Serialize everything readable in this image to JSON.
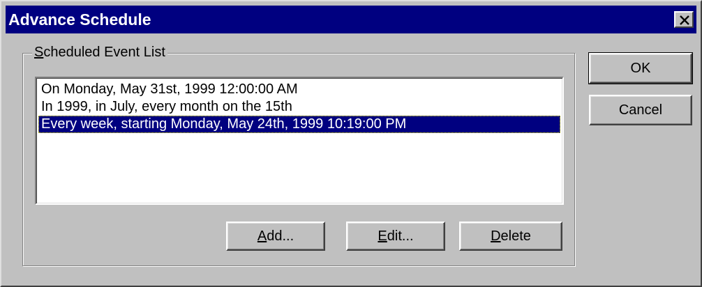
{
  "window": {
    "title": "Advance Schedule",
    "close_icon": "close-icon"
  },
  "group": {
    "legend_mnemonic": "S",
    "legend_rest": "cheduled Event List"
  },
  "events": [
    {
      "label": "On Monday, May 31st, 1999 12:00:00 AM",
      "selected": false
    },
    {
      "label": "In 1999, in July, every month on the 15th",
      "selected": false
    },
    {
      "label": "Every week, starting Monday, May 24th, 1999 10:19:00 PM",
      "selected": true
    }
  ],
  "buttons": {
    "add": {
      "mnemonic": "A",
      "rest": "dd..."
    },
    "edit": {
      "mnemonic": "E",
      "rest": "dit..."
    },
    "delete": {
      "mnemonic": "D",
      "rest": "elete"
    },
    "ok": "OK",
    "cancel": "Cancel"
  },
  "colors": {
    "titlebar": "#000080",
    "face": "#c0c0c0",
    "selection": "#000080"
  }
}
